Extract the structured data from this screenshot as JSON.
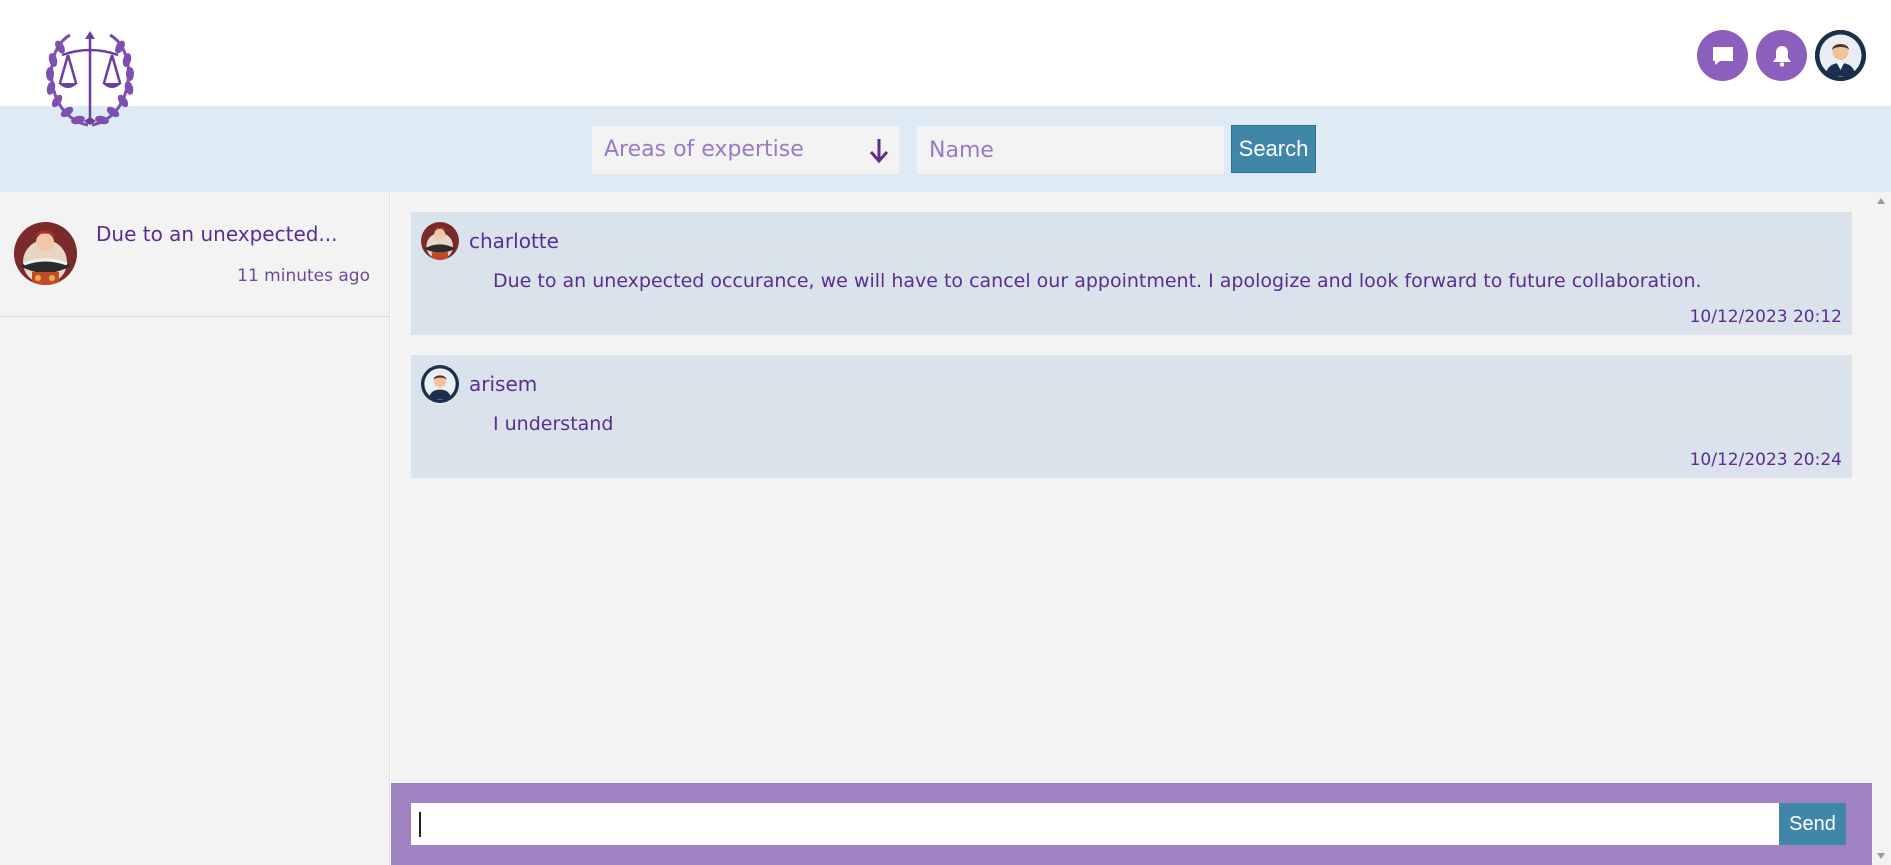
{
  "header": {
    "logo": "scales-of-justice-laurel-logo",
    "icons": {
      "messages": "chat-bubble-icon",
      "notifications": "bell-icon",
      "profile": "user-avatar"
    }
  },
  "search": {
    "expertise_label": "Areas of expertise",
    "name_placeholder": "Name",
    "name_value": "",
    "search_label": "Search"
  },
  "sidebar": {
    "conversations": [
      {
        "preview": "Due to an unexpected...",
        "time": "11 minutes ago"
      }
    ]
  },
  "chat": {
    "messages": [
      {
        "author": "charlotte",
        "text": "Due to an unexpected occurance, we will have to cancel our appointment. I apologize and look forward to future collaboration.",
        "timestamp": "10/12/2023 20:12"
      },
      {
        "author": "arisem",
        "text": "I understand",
        "timestamp": "10/12/2023 20:24"
      }
    ]
  },
  "composer": {
    "value": "",
    "send_label": "Send"
  },
  "colors": {
    "accent_purple": "#8d5fbd",
    "text_purple": "#5b2d8e",
    "button_blue": "#3f86a8",
    "searchbar_bg": "#deebf5",
    "message_bg": "#dae3ec",
    "composer_bg": "#9e82c1"
  }
}
